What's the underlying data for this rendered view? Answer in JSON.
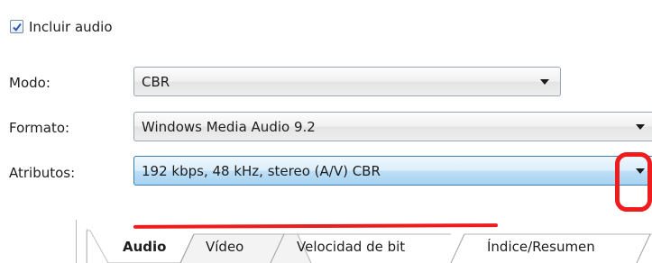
{
  "include_audio": {
    "label": "Incluir audio",
    "checked": true
  },
  "mode": {
    "label": "Modo:",
    "value": "CBR"
  },
  "format": {
    "label": "Formato:",
    "value": "Windows Media Audio 9.2"
  },
  "attributes": {
    "label": "Atributos:",
    "value": "192 kbps, 48 kHz, stereo (A/V) CBR"
  },
  "tabs": [
    {
      "label": "Audio",
      "selected": true
    },
    {
      "label": "Vídeo",
      "selected": false
    },
    {
      "label": "Velocidad de bit",
      "selected": false
    },
    {
      "label": "Índice/Resumen",
      "selected": false
    }
  ],
  "annotation_color": "#ee1c1c",
  "icons": {
    "checkbox": "checkmark-icon",
    "dropdown": "chevron-down-icon"
  }
}
